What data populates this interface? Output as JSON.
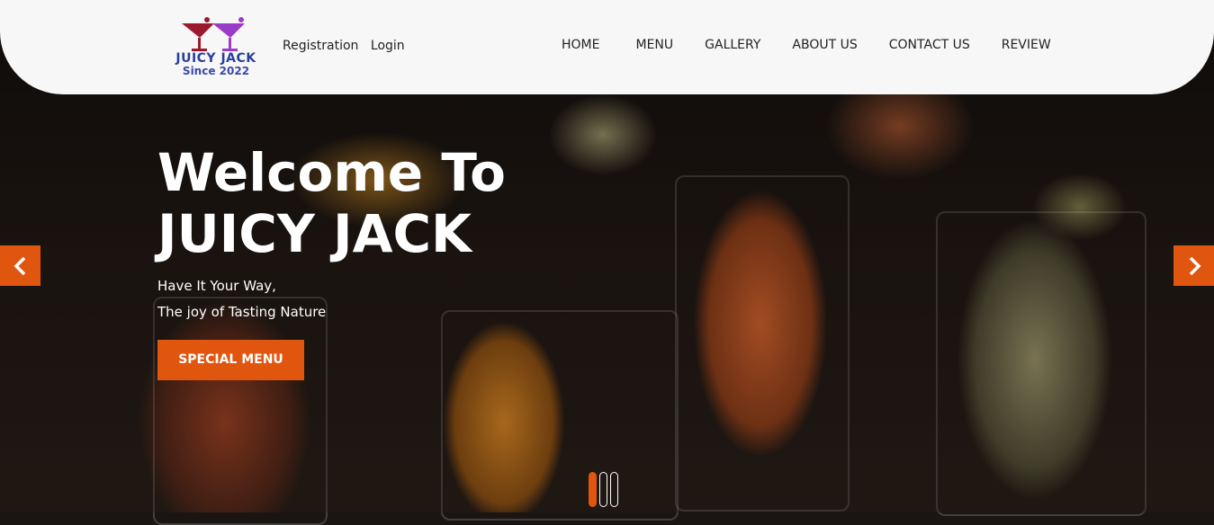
{
  "brand": {
    "name": "JUICY JACK",
    "since": "Since 2022",
    "colors": {
      "accent": "#e0560f",
      "logo_blue": "#2a3f9a",
      "header_bg": "#f7f7f8"
    }
  },
  "auth": {
    "registration": "Registration",
    "login": "Login"
  },
  "nav": {
    "items": [
      {
        "label": "HOME"
      },
      {
        "label": "MENU"
      },
      {
        "label": "GALLERY"
      },
      {
        "label": "ABOUT US"
      },
      {
        "label": "CONTACT US"
      },
      {
        "label": "REVIEW"
      }
    ]
  },
  "hero": {
    "title_line1": "Welcome To",
    "title_line2": "JUICY JACK",
    "tagline_line1": "Have It Your Way,",
    "tagline_line2": "The joy of Tasting Nature",
    "cta_label": "SPECIAL MENU"
  },
  "carousel": {
    "slides": 3,
    "active_slide": 1
  },
  "icons": {
    "prev": "chevron-left-icon",
    "next": "chevron-right-icon",
    "logo": "cocktail-glasses-icon"
  }
}
